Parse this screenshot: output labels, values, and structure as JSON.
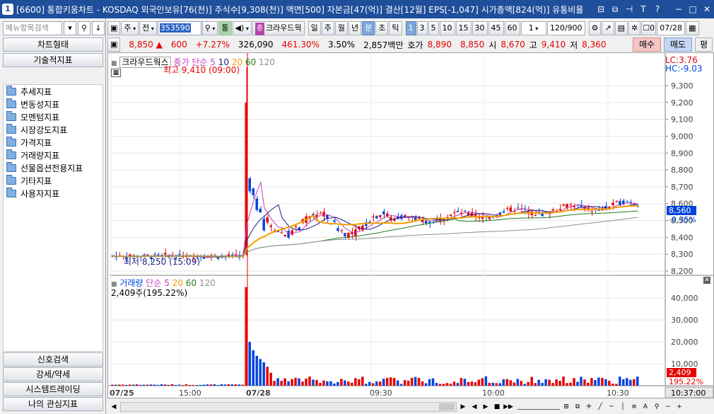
{
  "window": {
    "app_num": "1",
    "title": "[6600] 통합키움차트 - KOSDAQ 외국인보유[76(천)] 주식수[9,308(천)] 액면[500] 자본금[47(억)] 결산[12월] EPS[-1,047] 시가총액[824(억)] 유통비율"
  },
  "left_panel": {
    "search_placeholder": "메뉴항목검색",
    "chart_type_label": "차트형태",
    "indicators_label": "기술적지표",
    "tree": [
      "추세지표",
      "변동성지표",
      "모멘텀지표",
      "시장강도지표",
      "가격지표",
      "거래량지표",
      "선물옵션전용지표",
      "기타지표",
      "사용자지표"
    ],
    "bottom_buttons": [
      "신호검색",
      "강세/약세",
      "시스템트레이딩",
      "나의 관심지표"
    ]
  },
  "toolbar": {
    "period_week": "주",
    "prev": "전",
    "code": "353590",
    "stock_name": "크라우드웍",
    "periods": [
      "일",
      "주",
      "월",
      "년",
      "분",
      "초",
      "틱"
    ],
    "intervals": [
      "1",
      "3",
      "5",
      "10",
      "15",
      "30",
      "45",
      "60"
    ],
    "interval_select": "1",
    "count": "120",
    "count_total": "/900",
    "date": "07/28",
    "zero": "0"
  },
  "price": {
    "current": "8,850",
    "change": "600",
    "change_pct": "+7.27%",
    "volume": "326,090",
    "volume_pct": "461.30%",
    "turnover": "3.50%",
    "amount": "2,857백만",
    "ask_label": "호가",
    "ask1": "8,890",
    "ask2": "8,850",
    "open_label": "시",
    "open": "8,670",
    "high_label": "고",
    "high": "9,410",
    "low_label": "저",
    "low": "8,360",
    "buy": "매수",
    "sell": "매도",
    "flat": "평"
  },
  "chart": {
    "price_legend": {
      "name": "크라우드웍스",
      "ma_label": "종가 단순",
      "ma": [
        "5",
        "10",
        "20",
        "60",
        "120"
      ]
    },
    "high_annot": "최고 9,410 (09:00)",
    "low_annot": "최저 8,250 (15:09)",
    "lc": "LC:3.76",
    "hc": "HC:-9.03",
    "price_ticks": [
      "9,300",
      "9,200",
      "9,100",
      "9,000",
      "8,900",
      "8,800",
      "8,700",
      "8,600",
      "8,500",
      "8,400",
      "8,300",
      "8,200"
    ],
    "last_price": "8,560",
    "last_change": "-0.35%",
    "volume_legend": {
      "name": "거래량",
      "ma_label": "단순",
      "ma": [
        "5",
        "20",
        "60",
        "120"
      ]
    },
    "volume_info": "2,409주(195.22%)",
    "volume_ticks": [
      "40,000",
      "30,000",
      "20,000",
      "10,000"
    ],
    "last_volume": "2,409",
    "last_volume_pct": "195.22%",
    "time_labels": [
      "07/25",
      "15:00",
      "07/28",
      "09:30",
      "10:00",
      "10:30"
    ],
    "cursor_time": "10:37:00",
    "colors": {
      "up": "#e60000",
      "down": "#0044dd",
      "ma5": "#c040c0",
      "ma10": "#202080",
      "ma20": "#f0a000",
      "ma60": "#208020",
      "ma120": "#909090"
    }
  }
}
